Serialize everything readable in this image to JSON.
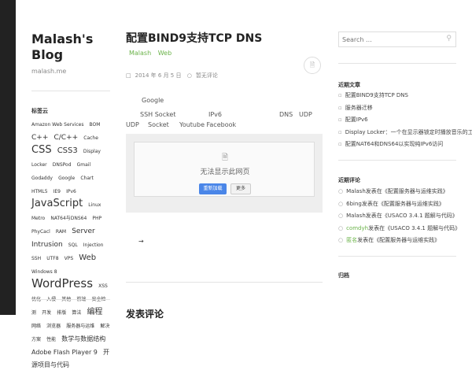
{
  "sidebar_left": {
    "blog_title": "Malash's Blog",
    "blog_url": "malash.me",
    "tags_heading": "标签云",
    "tags": [
      {
        "text": "Amazon Web Services",
        "size": "s6"
      },
      {
        "text": "BOM",
        "size": "s6"
      },
      {
        "text": "C++",
        "size": "s9"
      },
      {
        "text": "C/C++",
        "size": "s9"
      },
      {
        "text": "Cache",
        "size": "s6"
      },
      {
        "text": "CSS",
        "size": "s13"
      },
      {
        "text": "CSS3",
        "size": "s10"
      },
      {
        "text": "Display Locker",
        "size": "s6"
      },
      {
        "text": "DNSPod",
        "size": "s6"
      },
      {
        "text": "Gmail",
        "size": "s6"
      },
      {
        "text": "Godaddy",
        "size": "s6"
      },
      {
        "text": "Google",
        "size": "s6"
      },
      {
        "text": "Chart",
        "size": "s6"
      },
      {
        "text": "HTML5",
        "size": "s6"
      },
      {
        "text": "IE9",
        "size": "s6"
      },
      {
        "text": "IPv6",
        "size": "s6"
      },
      {
        "text": "JavaScript",
        "size": "s13"
      },
      {
        "text": "Linux",
        "size": "s6"
      },
      {
        "text": "Metro",
        "size": "s6"
      },
      {
        "text": "NAT64与DNS64",
        "size": "s6"
      },
      {
        "text": "PHP",
        "size": "s6"
      },
      {
        "text": "PhyCacl",
        "size": "s6"
      },
      {
        "text": "RAM",
        "size": "s6"
      },
      {
        "text": "Server Intrusion",
        "size": "s9"
      },
      {
        "text": "SQL",
        "size": "s6"
      },
      {
        "text": "Injection",
        "size": "s6"
      },
      {
        "text": "SSH",
        "size": "s6"
      },
      {
        "text": "UTF8",
        "size": "s6"
      },
      {
        "text": "VPS",
        "size": "s6"
      },
      {
        "text": "Web",
        "size": "s10"
      },
      {
        "text": "Windows 8",
        "size": "s6"
      },
      {
        "text": "WordPress",
        "size": "s15"
      },
      {
        "text": "XSS",
        "size": "s6"
      },
      {
        "text": "优化",
        "size": "s6"
      },
      {
        "text": "入侵",
        "size": "s6"
      },
      {
        "text": "其他",
        "size": "s6"
      },
      {
        "text": "前端",
        "size": "s6"
      },
      {
        "text": "安全检测",
        "size": "s6"
      },
      {
        "text": "开发",
        "size": "s6"
      },
      {
        "text": "排版",
        "size": "s6"
      },
      {
        "text": "算法",
        "size": "s6"
      },
      {
        "text": "编程",
        "size": "s10"
      },
      {
        "text": "网络",
        "size": "s6"
      },
      {
        "text": "浏览器",
        "size": "s6"
      },
      {
        "text": "服务器与运维",
        "size": "s6"
      },
      {
        "text": "解决方案",
        "size": "s6"
      },
      {
        "text": "性能",
        "size": "s6"
      },
      {
        "text": "数学与数据结构",
        "size": "s8"
      },
      {
        "text": "Adobe Flash Player 9",
        "size": "s8"
      },
      {
        "text": "开源项目与代码",
        "size": "s8"
      }
    ]
  },
  "post": {
    "title": "配置BIND9支持TCP DNS",
    "categories": [
      "Malash",
      "Web"
    ],
    "format_icon": "document-icon",
    "meta": {
      "date": "2014 年 6 月 5 日",
      "comments": "暂无评论"
    },
    "body": {
      "google": "Google",
      "ssh_socket": "SSH Socket",
      "ipv6": "IPv6",
      "dns": "DNS",
      "udp1": "UDP",
      "udp2": "UDP",
      "socket": "Socket",
      "youtube": "Youtube Facebook"
    },
    "frame": {
      "error_message": "无法显示此网页",
      "primary_button": "重新加载",
      "secondary_button": "更多"
    },
    "arrow": "→",
    "next_title": "发表评论"
  },
  "sidebar_right": {
    "search_placeholder": "Search ...",
    "recent_posts_heading": "近期文章",
    "recent_posts": [
      "配置BIND9支持TCP DNS",
      "服务器迁移",
      "配置IPv6",
      "Display Locker：一个在显示器锁定时播放音乐的工具",
      "配置NAT64和DNS64以实现纯IPv6访问"
    ],
    "recent_comments_heading": "近期评论",
    "recent_comments": [
      {
        "author": "Malash",
        "text": "发表在《配置服务器与运维实践》",
        "highlight": false
      },
      {
        "author": "6bing",
        "text": "发表在《配置服务器与运维实践》",
        "highlight": false
      },
      {
        "author": "Malash",
        "text": "发表在《USACO 3.4.1 题解与代码》",
        "highlight": false
      },
      {
        "author": "comdyh",
        "text": "发表在《USACO 3.4.1 题解与代码》",
        "highlight": true
      },
      {
        "author": "匿名",
        "text": "发表在《配置服务器与运维实践》",
        "highlight": true
      }
    ],
    "archives_heading": "归档"
  },
  "colors": {
    "accent_green": "#6bb34a",
    "leftbar": "#222222",
    "button_blue": "#4a86e8"
  }
}
